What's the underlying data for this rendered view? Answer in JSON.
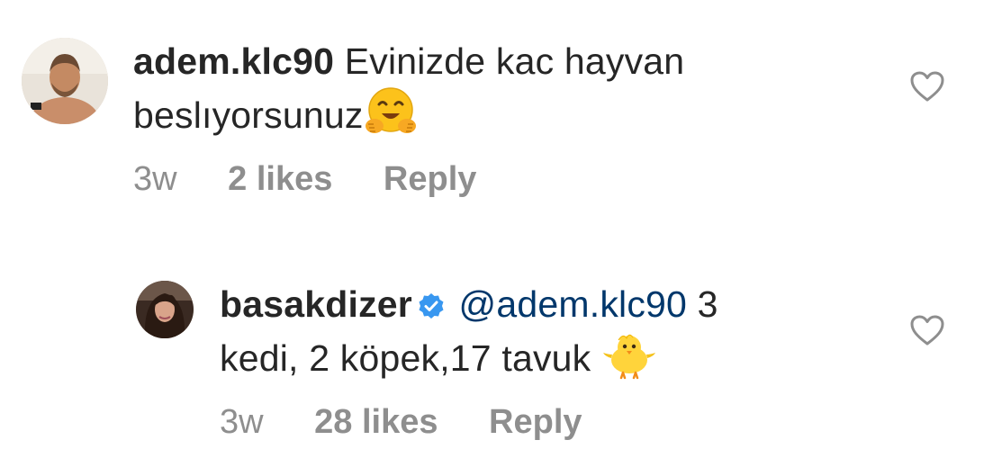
{
  "comments": [
    {
      "username": "adem.klc90",
      "text_line1": "Evinizde kac hayvan",
      "text_line2": "beslıyorsunuz",
      "emoji": "hugging-face",
      "time": "3w",
      "likes": "2 likes",
      "reply": "Reply"
    },
    {
      "username": "basakdizer",
      "verified": true,
      "mention": "@adem.klc90",
      "text_after_mention": "3",
      "text_line2": "kedi, 2 köpek,17 tavuk",
      "emoji": "baby-chick",
      "time": "3w",
      "likes": "28 likes",
      "reply": "Reply"
    }
  ],
  "colors": {
    "text": "#262626",
    "meta": "#8e8e8e",
    "mention": "#00376b",
    "verified": "#3897f0"
  }
}
